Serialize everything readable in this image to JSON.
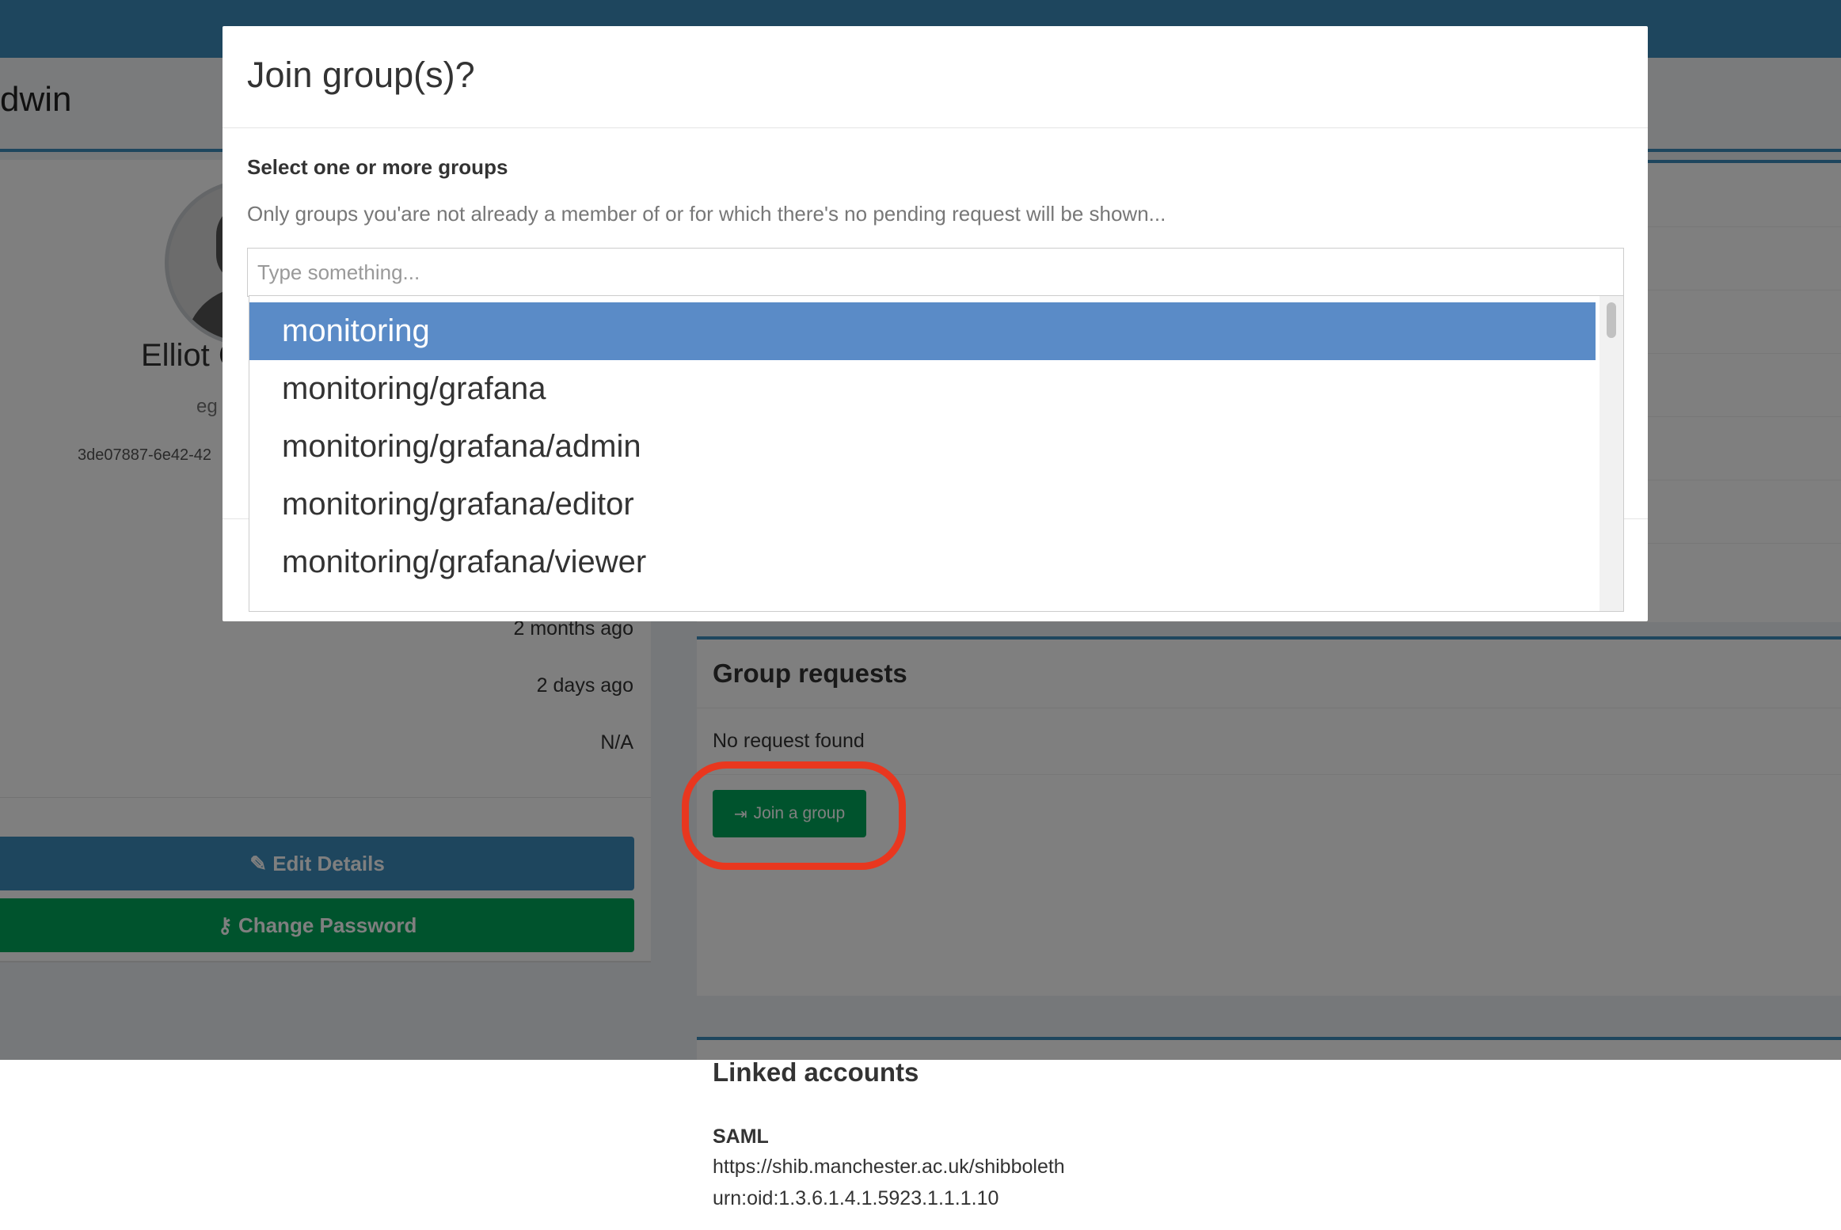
{
  "page": {
    "title": "dwin"
  },
  "profile": {
    "name": "Elliot C",
    "username": "eg",
    "uuid": "3de07887-6e42-42",
    "stats": {
      "created": "2 months ago",
      "last_login": "2 days ago",
      "expiry": "N/A"
    },
    "edit_button": "Edit Details",
    "change_password_button": "Change Password"
  },
  "group_requests": {
    "title": "Group requests",
    "empty_text": "No request found",
    "join_button": "Join a group"
  },
  "linked_accounts": {
    "title": "Linked accounts",
    "provider": "SAML",
    "issuer": "https://shib.manchester.ac.uk/shibboleth",
    "attribute": "urn:oid:1.3.6.1.4.1.5923.1.1.1.10"
  },
  "modal": {
    "title": "Join group(s)?",
    "field_label": "Select one or more groups",
    "help_text": "Only groups you'are not already a member of or for which there's no pending request will be shown...",
    "search_placeholder": "Type something...",
    "search_value": "",
    "options": [
      {
        "label": "monitoring",
        "selected": true
      },
      {
        "label": "monitoring/grafana",
        "selected": false
      },
      {
        "label": "monitoring/grafana/admin",
        "selected": false
      },
      {
        "label": "monitoring/grafana/editor",
        "selected": false
      },
      {
        "label": "monitoring/grafana/viewer",
        "selected": false
      }
    ]
  },
  "colors": {
    "primary": "#3c8dbc",
    "success": "#00a65a",
    "warning": "#f39c12",
    "highlight": "#5a8bc7",
    "annotation": "#e8371f"
  },
  "icons": {
    "edit": "pencil-icon",
    "password": "key-icon",
    "join": "sign-in-icon"
  }
}
